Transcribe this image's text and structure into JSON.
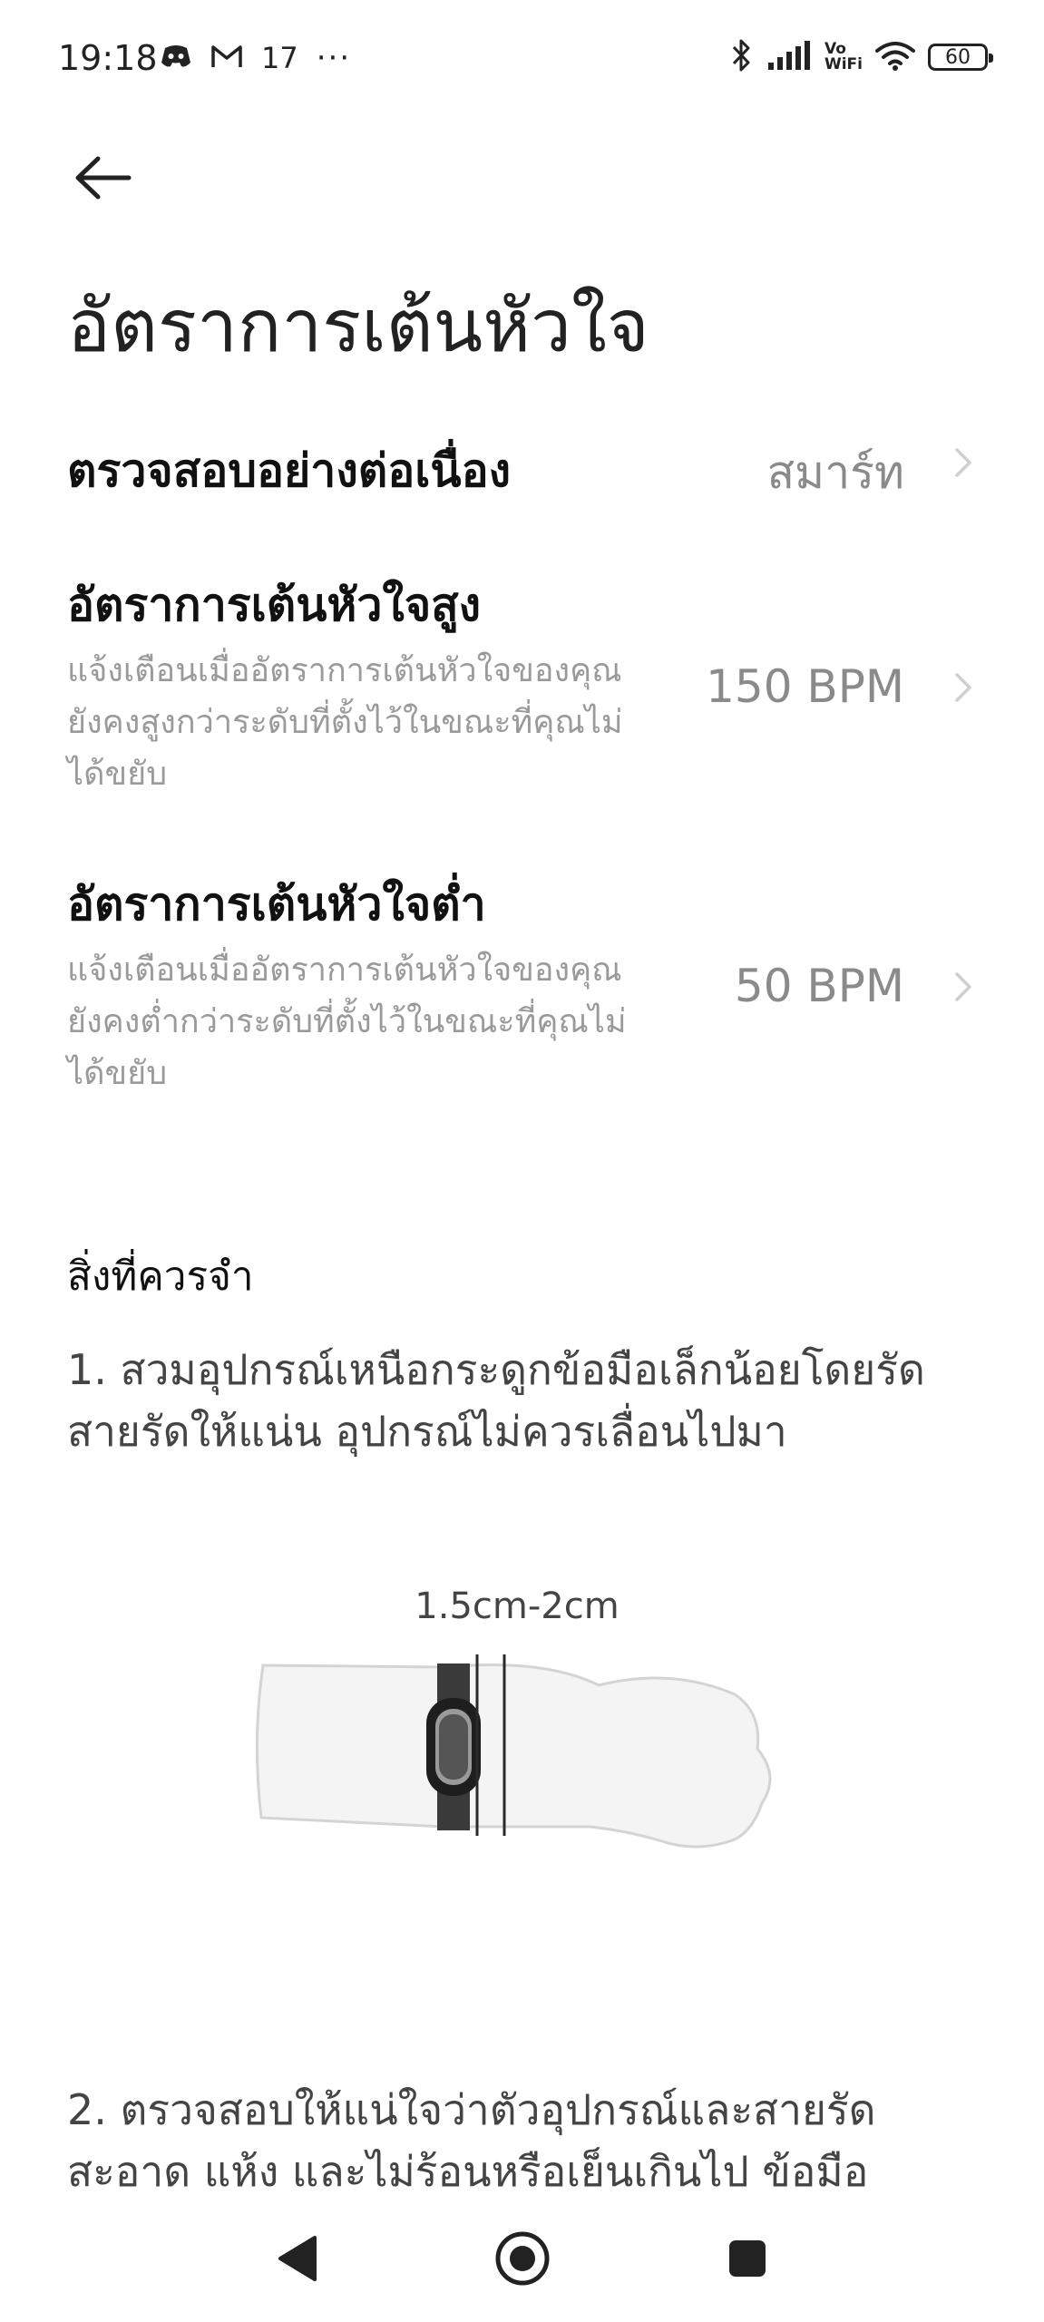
{
  "status_bar": {
    "time": "19:18",
    "notification_count": "17",
    "more_indicator": "···",
    "vo_label": "Vo",
    "wifi_label": "WiFi",
    "battery_level": "60",
    "left_icons": [
      "discord-icon",
      "gmail-icon"
    ],
    "right_icons": [
      "bluetooth-icon",
      "signal-icon",
      "vowifi-icon",
      "wifi-icon",
      "battery-icon"
    ]
  },
  "header": {
    "back_icon": "arrow-left-icon",
    "title": "อัตราการเต้นหัวใจ"
  },
  "settings": [
    {
      "title": "ตรวจสอบอย่างต่อเนื่อง",
      "value": "สมาร์ท"
    },
    {
      "title": "อัตราการเต้นหัวใจสูง",
      "description": "แจ้งเตือนเมื่ออัตราการเต้นหัวใจของคุณยังคงสูงกว่าระดับที่ตั้งไว้ในขณะที่คุณไม่ได้ขยับ",
      "value": "150 BPM"
    },
    {
      "title": "อัตราการเต้นหัวใจต่ำ",
      "description": "แจ้งเตือนเมื่ออัตราการเต้นหัวใจของคุณยังคงต่ำกว่าระดับที่ตั้งไว้ในขณะที่คุณไม่ได้ขยับ",
      "value": "50 BPM"
    }
  ],
  "tips": {
    "heading": "สิ่งที่ควรจำ",
    "items": [
      "1. สวมอุปกรณ์เหนือกระดูกข้อมือเล็กน้อยโดยรัดสายรัดให้แน่น อุปกรณ์ไม่ควรเลื่อนไปมา",
      "2. ตรวจสอบให้แน่ใจว่าตัวอุปกรณ์และสายรัดสะอาด แห้ง และไม่ร้อนหรือเย็นเกินไป ข้อมือ"
    ],
    "illustration_label": "1.5cm-2cm"
  },
  "nav_bar": {
    "icons": [
      "back-triangle-icon",
      "home-circle-icon",
      "recents-square-icon"
    ]
  },
  "colors": {
    "background": "#ffffff",
    "title_text": "#111111",
    "secondary_text": "#9a9a9a",
    "value_text": "#8a8a8a"
  }
}
